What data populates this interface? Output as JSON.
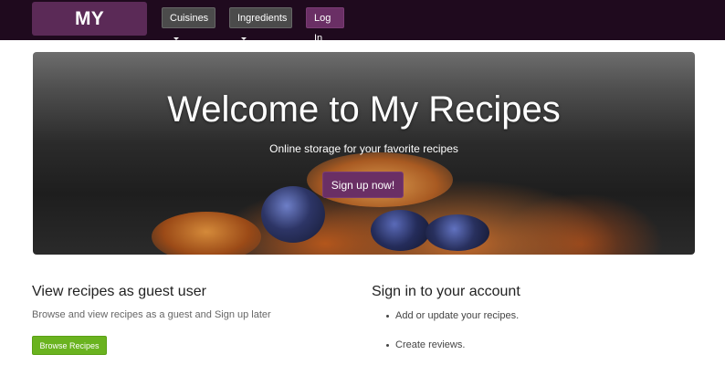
{
  "navbar": {
    "brand": "MY RECIPES",
    "cuisines_label": "Cuisines",
    "ingredients_label": "Ingredients",
    "login_label": "Log In"
  },
  "hero": {
    "title": "Welcome to My Recipes",
    "subtitle": "Online storage for your favorite recipes",
    "cta_label": "Sign up now!"
  },
  "guest": {
    "heading": "View recipes as guest user",
    "description": "Browse and view recipes as a guest and Sign up later",
    "button_label": "Browse Recipes"
  },
  "account": {
    "heading": "Sign in to your account",
    "items": [
      "Add or update your recipes.",
      "Create reviews."
    ]
  },
  "colors": {
    "navbar_bg": "#1f0a1e",
    "brand_bg": "#5b2a57",
    "primary": "#6a2f65",
    "success": "#6ab31f"
  }
}
